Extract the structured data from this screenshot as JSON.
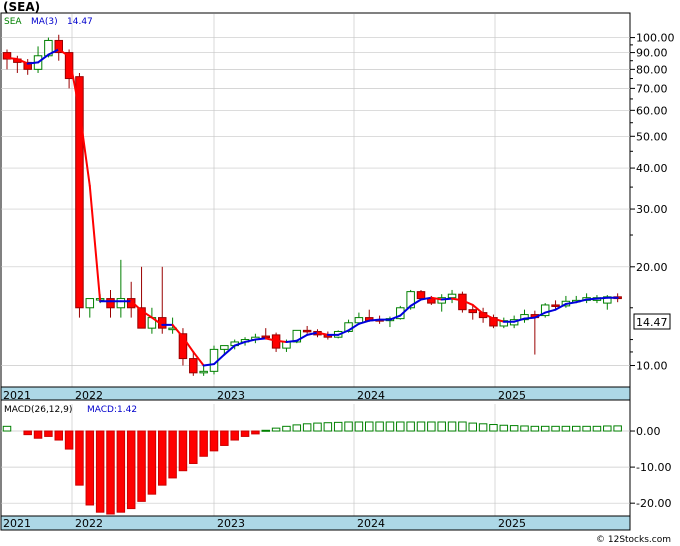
{
  "ticker": "(SEA)",
  "credit": "© 12Stocks.com",
  "price_panel": {
    "legend_symbol": "SEA",
    "legend_ma": "MA(3)",
    "legend_ma_value": "14.47",
    "last_price_label": "14.47",
    "symbol_color": "#008000",
    "ma_label_color": "#0000cc"
  },
  "macd_panel": {
    "legend_name": "MACD(26,12,9)",
    "legend_value_label": "MACD:1.42"
  },
  "colors": {
    "up_candle": "#008000",
    "down_candle": "#ff0000",
    "ma_rising": "#0000dd",
    "ma_falling": "#ff0000",
    "axis_band": "#add8e6",
    "grid": "#c8c8c8"
  },
  "chart_data": [
    {
      "type": "candlestick",
      "title": "(SEA)",
      "y_scale": "log",
      "ylim": [
        8.6,
        118
      ],
      "y_ticks": [
        100,
        90,
        80,
        70,
        60,
        50,
        40,
        30,
        20,
        10
      ],
      "y_tick_labels": [
        "100.00",
        "90.00",
        "80.00",
        "70.00",
        "60.00",
        "50.00",
        "40.00",
        "30.00",
        "20.00",
        "10.00"
      ],
      "x_axis_labels": [
        "2021",
        "2022",
        "2023",
        "2024",
        "2025"
      ],
      "series": [
        {
          "name": "SEA",
          "candles": [
            [
              90,
              92,
              80,
              86
            ],
            [
              86,
              88,
              78,
              84
            ],
            [
              84,
              86,
              77,
              80
            ],
            [
              80,
              94,
              78,
              88
            ],
            [
              88,
              100,
              87,
              98
            ],
            [
              98,
              102,
              85,
              90
            ],
            [
              90,
              92,
              70,
              75
            ],
            [
              76,
              78,
              14,
              15
            ],
            [
              15,
              16,
              14,
              16
            ],
            [
              16,
              16.5,
              15.5,
              16
            ],
            [
              16,
              17,
              14,
              15
            ],
            [
              15,
              21,
              14,
              16
            ],
            [
              16,
              18,
              14,
              15
            ],
            [
              15,
              20,
              13,
              13
            ],
            [
              13,
              15,
              12.5,
              14
            ],
            [
              14,
              20,
              12.5,
              13
            ],
            [
              13,
              14,
              12.5,
              13
            ],
            [
              12.5,
              13,
              10,
              10.5
            ],
            [
              10.5,
              11,
              9.3,
              9.5
            ],
            [
              9.5,
              10,
              9.3,
              9.6
            ],
            [
              9.6,
              11.5,
              9.4,
              11.2
            ],
            [
              11.2,
              11.5,
              10.8,
              11.5
            ],
            [
              11.5,
              12,
              11.2,
              11.8
            ],
            [
              11.8,
              12.2,
              11.5,
              12
            ],
            [
              12,
              12.5,
              11.7,
              12.2
            ],
            [
              12.3,
              13,
              12,
              12.2
            ],
            [
              12.4,
              12.6,
              11,
              11.3
            ],
            [
              11.3,
              12,
              11,
              11.8
            ],
            [
              11.8,
              12.8,
              11.7,
              12.8
            ],
            [
              12.8,
              13.2,
              12.5,
              12.7
            ],
            [
              12.7,
              12.9,
              12.2,
              12.4
            ],
            [
              12.4,
              12.7,
              12,
              12.2
            ],
            [
              12.2,
              12.8,
              12.1,
              12.7
            ],
            [
              12.7,
              13.8,
              12.6,
              13.5
            ],
            [
              13.5,
              14.5,
              13.3,
              14
            ],
            [
              14,
              14.8,
              13.6,
              13.7
            ],
            [
              13.8,
              14.2,
              13.4,
              13.7
            ],
            [
              13.7,
              14.1,
              13.1,
              13.9
            ],
            [
              13.9,
              15.2,
              13.8,
              15
            ],
            [
              15,
              17,
              14.8,
              16.8
            ],
            [
              16.8,
              17,
              15.8,
              16
            ],
            [
              16,
              16.3,
              15.3,
              15.5
            ],
            [
              15.5,
              16.5,
              14.6,
              16.1
            ],
            [
              16.1,
              17,
              15.5,
              16.5
            ],
            [
              16.5,
              16.8,
              14.5,
              14.8
            ],
            [
              14.8,
              15.2,
              13.8,
              14.5
            ],
            [
              14.5,
              15,
              13.5,
              14
            ],
            [
              14,
              14.3,
              13,
              13.2
            ],
            [
              13.2,
              14,
              13,
              13.7
            ],
            [
              13.3,
              14.2,
              13,
              13.8
            ],
            [
              13.8,
              14.8,
              13.5,
              14.3
            ],
            [
              14.3,
              14.7,
              10.8,
              14
            ],
            [
              14.2,
              15.5,
              14,
              15.3
            ],
            [
              15.3,
              15.8,
              14.8,
              15.2
            ],
            [
              15.2,
              16.3,
              15,
              15.7
            ],
            [
              15.7,
              16.3,
              15.5,
              15.8
            ],
            [
              15.8,
              16.6,
              15.5,
              16.1
            ],
            [
              15.8,
              16.4,
              15.5,
              16.1
            ],
            [
              15.5,
              16.4,
              14.8,
              16.2
            ],
            [
              16.2,
              16.6,
              15.6,
              16
            ]
          ]
        },
        {
          "name": "MA(3)",
          "values": [
            86.7,
            86,
            83.3,
            84,
            88.7,
            92,
            87.7,
            60,
            35.3,
            15.7,
            15.7,
            15.7,
            15.7,
            14.7,
            14,
            13.3,
            13.3,
            12.2,
            11,
            10,
            10.1,
            10.8,
            11.5,
            11.8,
            12,
            12.1,
            11.9,
            11.8,
            11.9,
            12.4,
            12.6,
            12.4,
            12.4,
            12.8,
            13.4,
            13.7,
            13.8,
            13.8,
            14.2,
            15.2,
            15.9,
            16.1,
            15.9,
            16,
            15.8,
            15.3,
            14.4,
            13.9,
            13.6,
            13.6,
            13.9,
            14,
            14.5,
            14.8,
            15.4,
            15.6,
            15.9,
            16,
            16.1,
            16.1
          ]
        }
      ]
    },
    {
      "type": "bar",
      "title": "MACD(26,12,9)",
      "ylim": [
        -23,
        2.5
      ],
      "y_ticks": [
        0,
        -10,
        -20
      ],
      "y_tick_labels": [
        "0.00",
        "-10.00",
        "-20.00"
      ],
      "x_axis_labels": [
        "2021",
        "2022",
        "2023",
        "2024",
        "2025"
      ],
      "series": [
        {
          "name": "MACD",
          "values": [
            1.3,
            0,
            -1,
            -2,
            -1.5,
            -2.5,
            -5,
            -15,
            -20.5,
            -22.5,
            -23,
            -22.5,
            -21.5,
            -19.5,
            -17.5,
            -15,
            -13,
            -11,
            -9,
            -7,
            -5.5,
            -4,
            -2.5,
            -1.5,
            -0.8,
            0.2,
            0.8,
            1.3,
            1.7,
            2,
            2.2,
            2.3,
            2.4,
            2.5,
            2.5,
            2.5,
            2.5,
            2.5,
            2.5,
            2.5,
            2.5,
            2.5,
            2.5,
            2.5,
            2.5,
            2.2,
            2,
            1.8,
            1.6,
            1.5,
            1.4,
            1.3,
            1.3,
            1.3,
            1.3,
            1.3,
            1.3,
            1.3,
            1.4,
            1.42
          ]
        }
      ]
    }
  ]
}
